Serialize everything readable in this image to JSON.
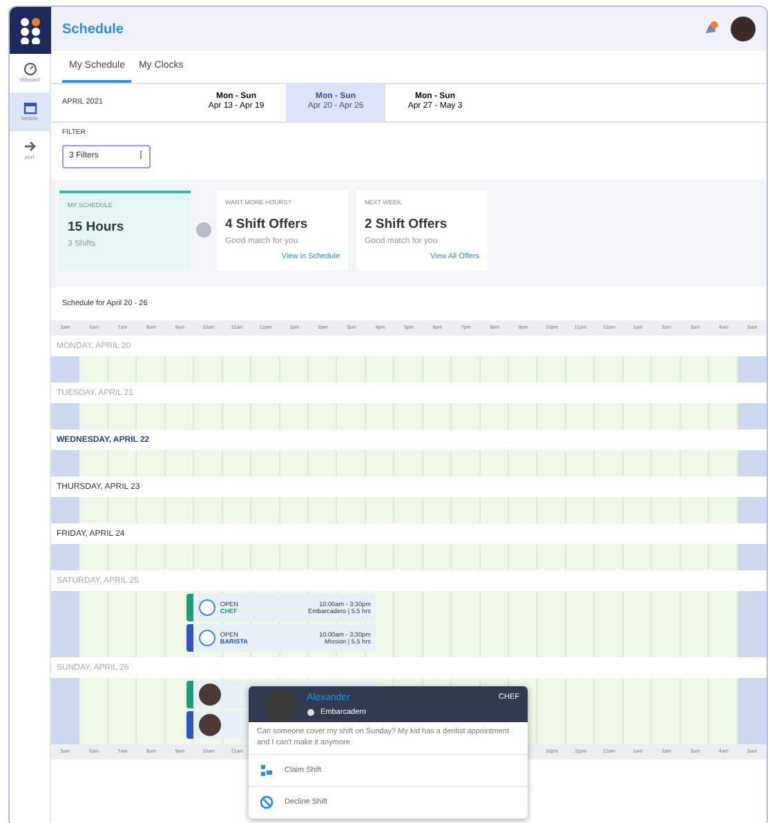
{
  "app": {
    "title": "Schedule",
    "notification_badge": true
  },
  "sidebar": [
    {
      "label": "shboard",
      "selected": false
    },
    {
      "label": "hedule",
      "selected": true
    },
    {
      "label": "port",
      "selected": false
    }
  ],
  "tabs": [
    {
      "label": "My Schedule",
      "selected": true
    },
    {
      "label": "My Clocks",
      "selected": false
    }
  ],
  "month": "APRIL 2021",
  "weeks": [
    {
      "label": "Mon - Sun",
      "range": "Apr 13 - Apr 19",
      "selected": false
    },
    {
      "label": "Mon - Sun",
      "range": "Apr 20 - Apr 26",
      "selected": true
    },
    {
      "label": "Mon - Sun",
      "range": "Apr 27 - May 3",
      "selected": false
    }
  ],
  "filter": {
    "label": "FILTER",
    "value": "3 Filters"
  },
  "summary_cards": [
    {
      "caption": "MY SCHEDULE",
      "title": "15 Hours",
      "subtitle": "3 Shifts",
      "selected": true
    },
    {
      "caption": "WANT MORE HOURS?",
      "title": "4 Shift Offers",
      "subtitle": "Good match for you",
      "link": "View in Schedule",
      "selected": false
    },
    {
      "caption": "NEXT WEEK",
      "title": "2 Shift Offers",
      "subtitle": "Good match for you",
      "link": "View All Offers",
      "selected": false
    }
  ],
  "schedule_title": "Schedule for April 20 - 26",
  "hours": [
    "5am",
    "6am",
    "7am",
    "8am",
    "9am",
    "10am",
    "11am",
    "12pm",
    "1pm",
    "2pm",
    "3pm",
    "4pm",
    "5pm",
    "6pm",
    "7pm",
    "8pm",
    "9pm",
    "10pm",
    "11pm",
    "12am",
    "1am",
    "2am",
    "3am",
    "4am",
    "5am"
  ],
  "hours_bottom": [
    "5am",
    "6am",
    "7am",
    "8am",
    "9am",
    "10am",
    "11am",
    "10pm",
    "11pm",
    "12am",
    "1am",
    "2am",
    "3am",
    "4am",
    "5am"
  ],
  "days": [
    {
      "label": "MONDAY, APRIL 20",
      "muted": true,
      "today": false
    },
    {
      "label": "TUESDAY, APRIL 21",
      "muted": true,
      "today": false
    },
    {
      "label": "WEDNESDAY, APRIL 22",
      "muted": false,
      "today": true
    },
    {
      "label": "THURSDAY, APRIL 23",
      "muted": false,
      "today": false
    },
    {
      "label": "FRIDAY, APRIL 24",
      "muted": false,
      "today": false
    },
    {
      "label": "SATURDAY, APRIL 25",
      "muted": true,
      "today": false,
      "shifts": [
        {
          "kind": "open",
          "status": "OPEN",
          "role": "CHEF",
          "time": "10:00am - 3:30pm",
          "place": "Embarcadero | 5.5 hrs",
          "color": "#1a9e7a"
        },
        {
          "kind": "open",
          "status": "OPEN",
          "role": "BARISTA",
          "time": "10:00am - 3:30pm",
          "place": "Mission | 5.5 hrs",
          "color": "#2a55c4"
        }
      ]
    },
    {
      "label": "SUNDAY, APRIL 26",
      "muted": true,
      "today": false,
      "shifts": [
        {
          "kind": "person",
          "color": "#1a9e7a"
        },
        {
          "kind": "person",
          "color": "#2a55c4"
        }
      ]
    }
  ],
  "popover": {
    "name": "Alexander",
    "role": "CHEF",
    "location": "Embarcadero",
    "message": "Can someone cover my shift on Sunday? My kid has a dentist appointment and I can't make it anymore",
    "actions": [
      {
        "label": "Claim Shift"
      },
      {
        "label": "Decline Shift"
      }
    ]
  }
}
